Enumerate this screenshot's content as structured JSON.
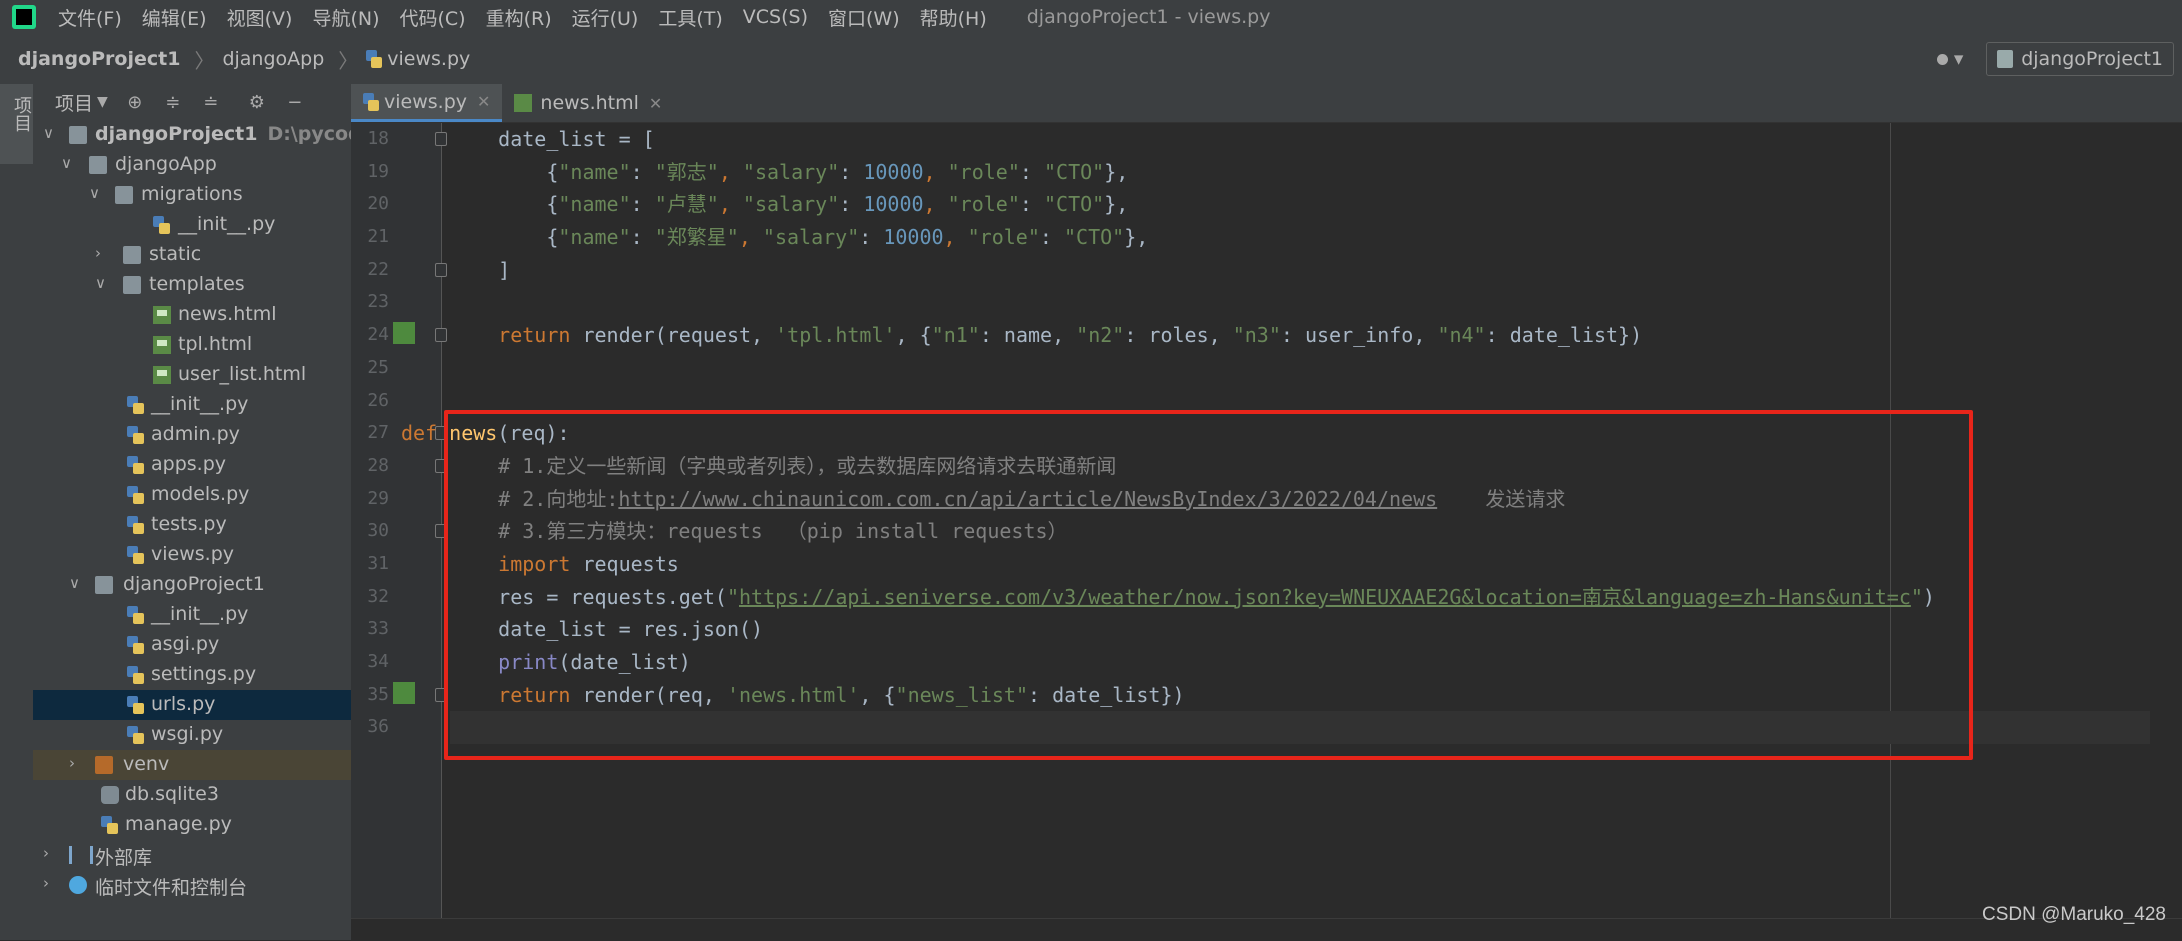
{
  "menubar": {
    "items": [
      "文件(F)",
      "编辑(E)",
      "视图(V)",
      "导航(N)",
      "代码(C)",
      "重构(R)",
      "运行(U)",
      "工具(T)",
      "VCS(S)",
      "窗口(W)",
      "帮助(H)"
    ],
    "window_title": "djangoProject1 - views.py"
  },
  "navbar": {
    "breadcrumbs": [
      "djangoProject1",
      "djangoApp",
      "views.py"
    ],
    "run_config": "djangoProject1"
  },
  "left_strip": {
    "label": "项目"
  },
  "project_panel": {
    "title": "项目",
    "tree": [
      {
        "label": "djangoProject1",
        "hint": "D:\\pycode\\d"
      },
      {
        "label": "djangoApp"
      },
      {
        "label": "migrations"
      },
      {
        "label": "__init__.py"
      },
      {
        "label": "static"
      },
      {
        "label": "templates"
      },
      {
        "label": "news.html"
      },
      {
        "label": "tpl.html"
      },
      {
        "label": "user_list.html"
      },
      {
        "label": "__init__.py"
      },
      {
        "label": "admin.py"
      },
      {
        "label": "apps.py"
      },
      {
        "label": "models.py"
      },
      {
        "label": "tests.py"
      },
      {
        "label": "views.py"
      },
      {
        "label": "djangoProject1"
      },
      {
        "label": "__init__.py"
      },
      {
        "label": "asgi.py"
      },
      {
        "label": "settings.py"
      },
      {
        "label": "urls.py"
      },
      {
        "label": "wsgi.py"
      },
      {
        "label": "venv"
      },
      {
        "label": "db.sqlite3"
      },
      {
        "label": "manage.py"
      },
      {
        "label": "外部库"
      },
      {
        "label": "临时文件和控制台"
      }
    ]
  },
  "tabs": [
    {
      "label": "views.py",
      "active": true
    },
    {
      "label": "news.html",
      "active": false
    }
  ],
  "editor": {
    "line_numbers": [
      "18",
      "19",
      "20",
      "21",
      "22",
      "23",
      "24",
      "25",
      "26",
      "27",
      "28",
      "29",
      "30",
      "31",
      "32",
      "33",
      "34",
      "35",
      "36"
    ],
    "tokens": {
      "l18_a": "    date_list = [",
      "l19_a": "        {",
      "l19_s1": "\"name\"",
      "l19_b": ": ",
      "l19_s2": "\"郭志\"",
      "l19_c": ", ",
      "l19_s3": "\"salary\"",
      "l19_d": ": ",
      "l19_n": "10000",
      "l19_e": ", ",
      "l19_s4": "\"role\"",
      "l19_f": ": ",
      "l19_s5": "\"CTO\"",
      "l19_g": "},",
      "l20_s2": "\"卢慧\"",
      "l21_s2": "\"郑繁星\"",
      "l22_a": "    ]",
      "l24_kw": "    return",
      "l24_a": " render(request, ",
      "l24_s1": "'tpl.html'",
      "l24_b": ", {",
      "l24_s2": "\"n1\"",
      "l24_c": ": name, ",
      "l24_s3": "\"n2\"",
      "l24_d": ": roles, ",
      "l24_s4": "\"n3\"",
      "l24_e": ": user_info, ",
      "l24_s5": "\"n4\"",
      "l24_f": ": date_list})",
      "l27_kw": "def",
      "l27_fn": "news",
      "l27_a": "(req):",
      "l28_cm": "    # 1.定义一些新闻（字典或者列表），或去数据库网络请求去联通新闻",
      "l29_cm": "    # 2.向地址:",
      "l29_link": "http://www.chinaunicom.com.cn/api/article/NewsByIndex/3/2022/04/news",
      "l29_cm2": "    发送请求",
      "l30_cm": "    # 3.第三方模块：requests  （pip install requests）",
      "l31_kw": "    import",
      "l31_a": " requests",
      "l32_a": "    res = requests.get(",
      "l32_q": "\"",
      "l32_link": "https://api.seniverse.com/v3/weather/now.json?key=WNEUXAAE2G&location=南京&language=zh-Hans&unit=c",
      "l32_q2": "\"",
      "l32_b": ")",
      "l33_a": "    date_list = res.json()",
      "l34_bi": "    print",
      "l34_a": "(date_list)",
      "l35_kw": "    return",
      "l35_a": " render(req, ",
      "l35_s1": "'news.html'",
      "l35_b": ", {",
      "l35_s2": "\"news_list\"",
      "l35_c": ": date_list})"
    }
  },
  "watermark": "CSDN @Maruko_428",
  "colors": {
    "accent": "#4a88c7",
    "highlight_box": "#e8251a",
    "keyword": "#cc7832",
    "string": "#6a8759",
    "number": "#6897bb"
  }
}
